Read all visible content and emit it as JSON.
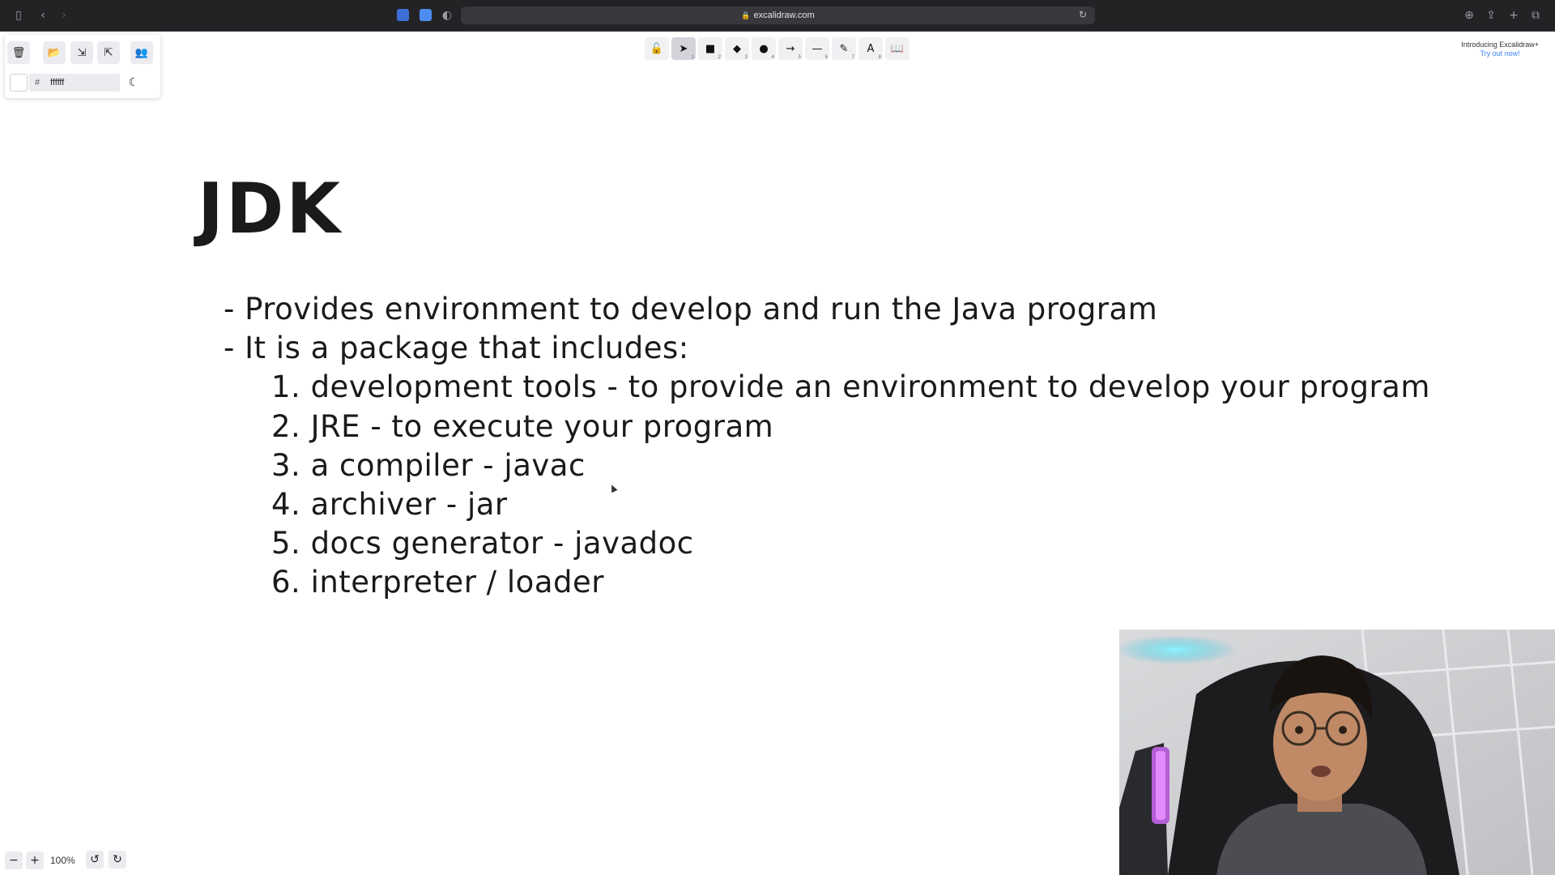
{
  "browser": {
    "url": "excalidraw.com"
  },
  "menu": {
    "bg_color_hash": "#",
    "bg_color_value": "ffffff"
  },
  "toolbar": {
    "tools": [
      {
        "name": "lock",
        "glyph": "🔓",
        "num": ""
      },
      {
        "name": "selection",
        "glyph": "➤",
        "num": "1"
      },
      {
        "name": "rectangle",
        "glyph": "■",
        "num": "2"
      },
      {
        "name": "diamond",
        "glyph": "◆",
        "num": "3"
      },
      {
        "name": "ellipse",
        "glyph": "●",
        "num": "4"
      },
      {
        "name": "arrow",
        "glyph": "→",
        "num": "5"
      },
      {
        "name": "line",
        "glyph": "—",
        "num": "6"
      },
      {
        "name": "draw",
        "glyph": "✎",
        "num": "7"
      },
      {
        "name": "text",
        "glyph": "A",
        "num": "8"
      },
      {
        "name": "library",
        "glyph": "📖",
        "num": ""
      }
    ]
  },
  "promo": {
    "line1": "Introducing Excalidraw+",
    "line2": "Try out now!"
  },
  "drawing": {
    "title": "JDK",
    "bullets": [
      "- Provides environment to develop and run the Java program",
      "- It is a package that includes:"
    ],
    "items": [
      "1. development tools - to provide an environment to develop your program",
      "2. JRE - to execute your program",
      "3. a compiler - javac",
      "4. archiver - jar",
      "5. docs generator - javadoc",
      "6. interpreter / loader"
    ]
  },
  "footer": {
    "zoom_out": "−",
    "zoom_in": "+",
    "zoom_level": "100%",
    "undo": "↺",
    "redo": "↻"
  }
}
